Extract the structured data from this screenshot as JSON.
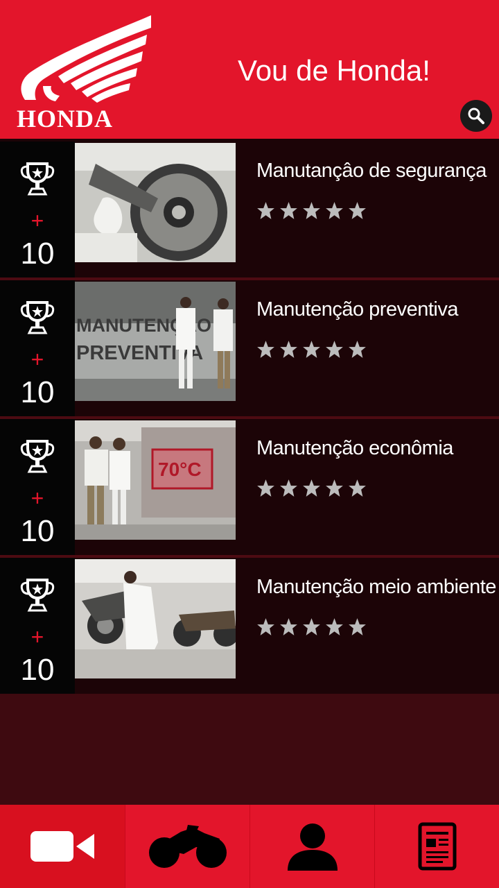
{
  "header": {
    "brand": "HONDA",
    "title": "Vou de Honda!"
  },
  "items": [
    {
      "title": "Manutançâo de segurança",
      "plus": "+",
      "points": "10",
      "rating": 5,
      "thumb": "motorcycle-wheel-chain-photo"
    },
    {
      "title": "Manutenção preventiva",
      "plus": "+",
      "points": "10",
      "rating": 5,
      "thumb": "manutencao-preventiva-studio-photo"
    },
    {
      "title": "Manutenção econômia",
      "plus": "+",
      "points": "10",
      "rating": 5,
      "thumb": "70c-presenters-photo"
    },
    {
      "title": "Manutenção meio ambiente",
      "plus": "+",
      "points": "10",
      "rating": 5,
      "thumb": "workshop-mechanic-photo"
    }
  ],
  "thumb_text": {
    "item2_line1": "MANUTENÇÃO",
    "item2_line2": "PREVENTIVA",
    "item3_temp": "70°C"
  },
  "nav": [
    {
      "icon": "video-camera-icon",
      "active": true
    },
    {
      "icon": "motorcycle-icon",
      "active": false
    },
    {
      "icon": "user-icon",
      "active": false
    },
    {
      "icon": "news-icon",
      "active": false
    }
  ],
  "colors": {
    "brand_red": "#e3152b",
    "list_bg": "#1c0407",
    "page_bg": "#3e0a10"
  }
}
